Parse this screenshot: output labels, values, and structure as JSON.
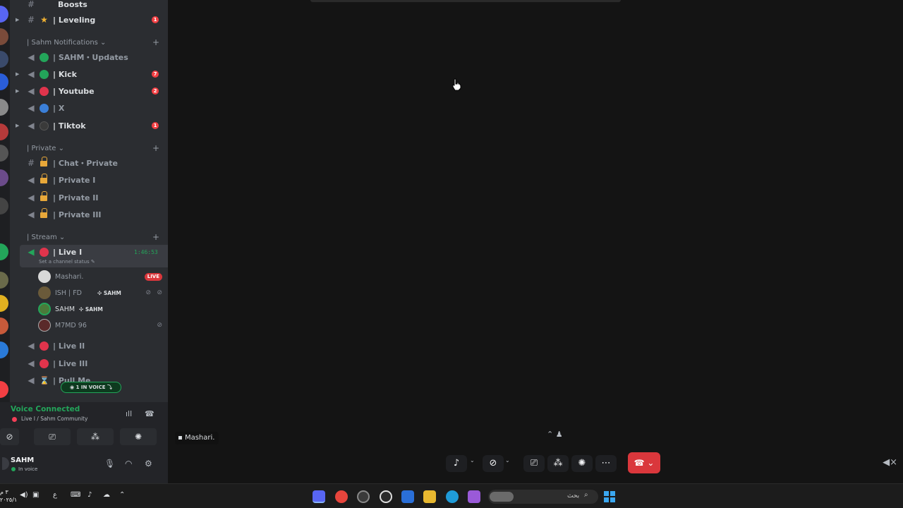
{
  "sidebar": {
    "top_partial_label": "Boosts",
    "categories": {
      "sahm_notifications": "| Sahm Notifications",
      "private": "| Private",
      "stream": "| Stream"
    },
    "channels": {
      "leveling": {
        "name": "| Leveling",
        "badge": "1"
      },
      "updates": {
        "name": "| SAHM・Updates"
      },
      "kick": {
        "name": "| Kick",
        "badge": "7"
      },
      "youtube": {
        "name": "| Youtube",
        "badge": "2"
      },
      "x": {
        "name": "| X"
      },
      "tiktok": {
        "name": "| Tiktok",
        "badge": "1"
      },
      "chat_private": {
        "name": "| Chat・Private"
      },
      "private1": {
        "name": "| Private I"
      },
      "private2": {
        "name": "| Private II"
      },
      "private3": {
        "name": "| Private III"
      },
      "live1": {
        "name": "| Live I",
        "timer": "1:46:53",
        "status": "Set a channel status"
      },
      "live2": {
        "name": "| Live II"
      },
      "live3": {
        "name": "| Live III"
      },
      "pull_me": {
        "name": "| Pull Me"
      }
    },
    "voice_users": [
      {
        "name": "Mashari.",
        "badge": "LIVE"
      },
      {
        "name": "ISH | FD",
        "tag": "SAHM"
      },
      {
        "name": "SAHM",
        "tag": "SAHM"
      },
      {
        "name": "M7MD 96"
      }
    ],
    "in_voice_pill": "1 IN VOICE"
  },
  "voice_panel": {
    "title": "Voice Connected",
    "subtitle": "Live I / Sahm Community"
  },
  "user_panel": {
    "name": "SAHM",
    "status": "In voice"
  },
  "stage": {
    "speaker_tag": "Mashari."
  },
  "taskbar": {
    "search_placeholder": "بحث",
    "clock_line1": "٣ م",
    "clock_line2": "٢٠٢٥/١"
  },
  "colors": {
    "green": "#23a55a",
    "red": "#da373c",
    "accent_blue": "#3ba7f0"
  }
}
